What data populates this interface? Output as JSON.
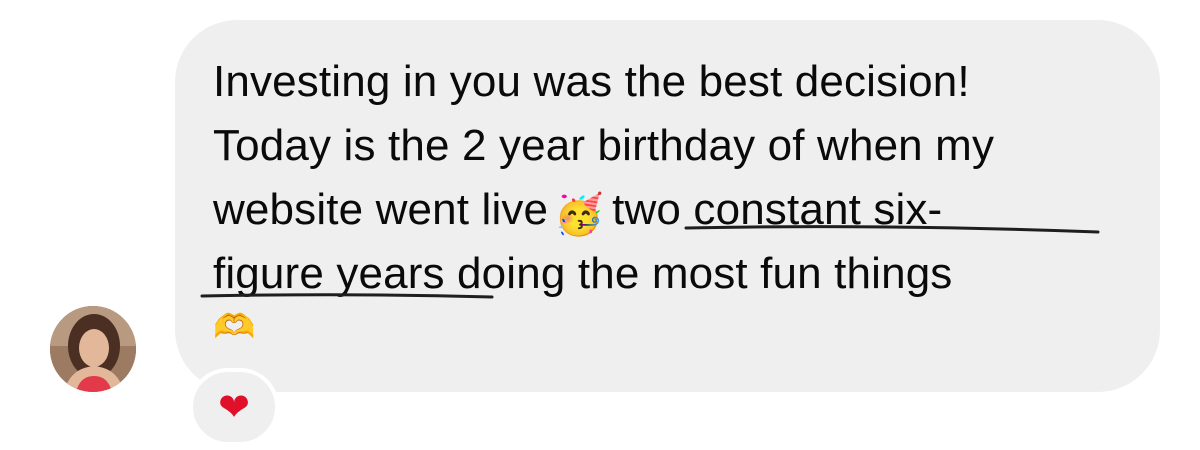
{
  "message": {
    "line1": "Investing in you was the best decision!",
    "line2": "Today is the 2 year birthday of when my",
    "line3_pre": "website went live",
    "line3_emoji": "🥳",
    "line3_post": "two constant six-",
    "line4_underlined": "figure years",
    "line4_rest": " doing the most fun things",
    "trailing_emoji": "🫶"
  },
  "reaction": {
    "emoji": "❤"
  },
  "colors": {
    "bubble": "#efefef",
    "text": "#0a0a0a",
    "underline": "#1e1e1e",
    "reaction_heart": "#e0102a"
  },
  "icons": {
    "avatar": "sender-avatar",
    "reaction": "heart-icon"
  }
}
